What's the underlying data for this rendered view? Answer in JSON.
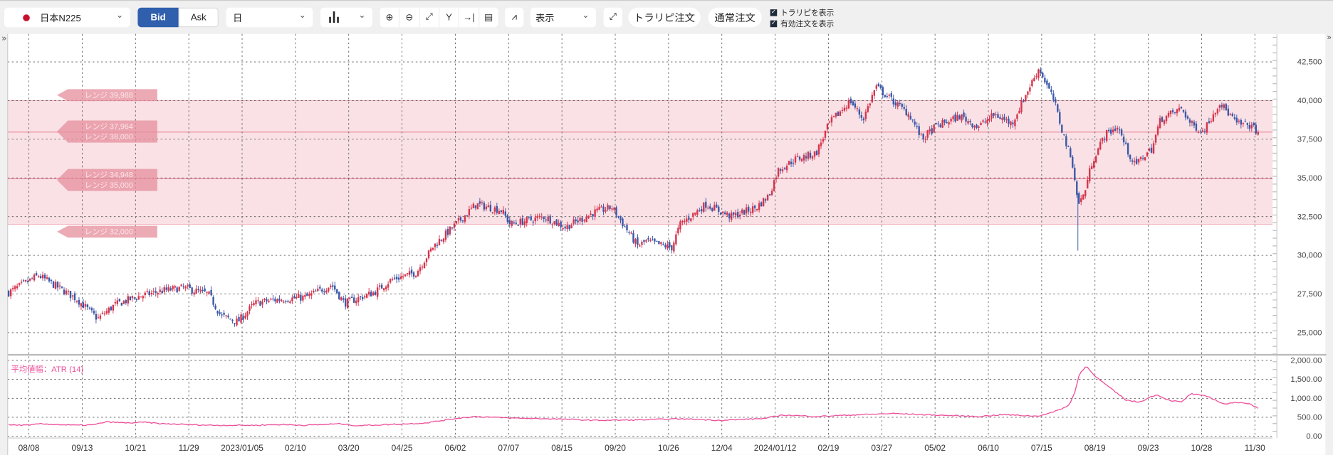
{
  "toolbar": {
    "symbol": "日本N225",
    "bid": "Bid",
    "ask": "Ask",
    "period": "日",
    "display": "表示",
    "trarepi_order": "トラリピ注文",
    "normal_order": "通常注文",
    "show_trarepi": "トラリピを表示",
    "show_active_orders": "有効注文を表示",
    "icons": [
      "zoom-in-icon",
      "zoom-out-icon",
      "fit-icon",
      "y-lock-icon",
      "scroll-end-icon",
      "document-icon"
    ]
  },
  "colors": {
    "up": "#d6344c",
    "down": "#3a58a8",
    "band": "#f9e1e5",
    "range_label": "#e58e9c",
    "atr": "#ee4f9a",
    "accent": "#2f5fad"
  },
  "ranges": [
    {
      "label": "レンジ 39,988",
      "value": 39988
    },
    {
      "label": "レンジ 37,964",
      "value": 37964
    },
    {
      "label": "レンジ 38,000",
      "value": 38000
    },
    {
      "label": "レンジ 34,948",
      "value": 34948
    },
    {
      "label": "レンジ 35,000",
      "value": 35000
    },
    {
      "label": "レンジ 32,000",
      "value": 32000
    }
  ],
  "atr_label": "平均値幅：ATR (14)",
  "chart_data": [
    {
      "type": "candlestick",
      "title": "日本N225",
      "ylim": [
        24000,
        43500
      ],
      "yticks": [
        "42,500",
        "40,000",
        "37,500",
        "35,000",
        "32,500",
        "30,000",
        "27,500",
        "25,000"
      ],
      "ytick_values": [
        42500,
        40000,
        37500,
        35000,
        32500,
        30000,
        27500,
        25000
      ],
      "xlabels": [
        "08/08",
        "09/13",
        "10/21",
        "11/29",
        "2023/01/05",
        "02/10",
        "03/20",
        "04/25",
        "06/02",
        "07/07",
        "08/15",
        "09/20",
        "10/26",
        "12/04",
        "2024/01/12",
        "02/19",
        "03/27",
        "05/02",
        "06/10",
        "07/15",
        "08/19",
        "09/23",
        "10/28",
        "11/30"
      ],
      "close_keypoints": [
        [
          -0.38,
          27600
        ],
        [
          0.18,
          28700
        ],
        [
          0.89,
          27200
        ],
        [
          1.29,
          25900
        ],
        [
          1.61,
          26800
        ],
        [
          2.01,
          27300
        ],
        [
          2.49,
          27700
        ],
        [
          2.89,
          27900
        ],
        [
          3.37,
          27500
        ],
        [
          3.6,
          26100
        ],
        [
          3.92,
          25700
        ],
        [
          4.24,
          26900
        ],
        [
          4.56,
          27100
        ],
        [
          5.2,
          27300
        ],
        [
          5.68,
          28100
        ],
        [
          5.92,
          26900
        ],
        [
          6.48,
          27600
        ],
        [
          6.79,
          28400
        ],
        [
          7.27,
          28900
        ],
        [
          7.59,
          30600
        ],
        [
          8.07,
          32200
        ],
        [
          8.39,
          33300
        ],
        [
          8.87,
          32900
        ],
        [
          9.03,
          32000
        ],
        [
          9.67,
          32500
        ],
        [
          10.06,
          31800
        ],
        [
          10.62,
          32800
        ],
        [
          10.94,
          33100
        ],
        [
          11.42,
          30600
        ],
        [
          11.58,
          30900
        ],
        [
          12.06,
          30500
        ],
        [
          12.22,
          32000
        ],
        [
          12.7,
          33300
        ],
        [
          13.17,
          32500
        ],
        [
          13.65,
          33100
        ],
        [
          13.89,
          33900
        ],
        [
          14.05,
          35500
        ],
        [
          14.37,
          36200
        ],
        [
          14.77,
          36600
        ],
        [
          15.01,
          38500
        ],
        [
          15.41,
          40000
        ],
        [
          15.65,
          38800
        ],
        [
          15.89,
          40900
        ],
        [
          16.2,
          40000
        ],
        [
          16.52,
          39100
        ],
        [
          16.76,
          37500
        ],
        [
          17.0,
          38300
        ],
        [
          17.48,
          39000
        ],
        [
          17.8,
          38300
        ],
        [
          18.12,
          39100
        ],
        [
          18.44,
          38500
        ],
        [
          18.76,
          40800
        ],
        [
          18.95,
          42100
        ],
        [
          19.23,
          40000
        ],
        [
          19.39,
          38000
        ],
        [
          19.59,
          35800
        ],
        [
          19.68,
          33300
        ],
        [
          19.79,
          33900
        ],
        [
          19.95,
          36100
        ],
        [
          20.19,
          37800
        ],
        [
          20.43,
          38300
        ],
        [
          20.59,
          36900
        ],
        [
          20.75,
          35800
        ],
        [
          20.91,
          36400
        ],
        [
          21.07,
          36900
        ],
        [
          21.23,
          38800
        ],
        [
          21.63,
          39500
        ],
        [
          21.79,
          38500
        ],
        [
          22.03,
          38000
        ],
        [
          22.34,
          39900
        ],
        [
          22.66,
          38500
        ],
        [
          22.9,
          38400
        ],
        [
          23.06,
          38000
        ]
      ]
    },
    {
      "type": "line",
      "title": "平均値幅：ATR (14)",
      "ylim": [
        0,
        2000
      ],
      "yticks": [
        "2,000.00",
        "1,500.00",
        "1,000.00",
        "500.00",
        "0.00"
      ],
      "ytick_values": [
        2000,
        1500,
        1000,
        500,
        0
      ],
      "keypoints": [
        [
          -0.38,
          300
        ],
        [
          0.02,
          290
        ],
        [
          0.18,
          330
        ],
        [
          0.89,
          290
        ],
        [
          1.21,
          300
        ],
        [
          1.45,
          380
        ],
        [
          1.85,
          350
        ],
        [
          2.17,
          370
        ],
        [
          2.49,
          330
        ],
        [
          3.44,
          290
        ],
        [
          4.24,
          290
        ],
        [
          4.72,
          310
        ],
        [
          5.2,
          290
        ],
        [
          5.84,
          330
        ],
        [
          6.16,
          280
        ],
        [
          6.95,
          320
        ],
        [
          7.43,
          350
        ],
        [
          8.07,
          480
        ],
        [
          8.39,
          520
        ],
        [
          9.03,
          480
        ],
        [
          9.82,
          460
        ],
        [
          10.62,
          420
        ],
        [
          11.42,
          430
        ],
        [
          12.22,
          460
        ],
        [
          13.01,
          420
        ],
        [
          13.81,
          470
        ],
        [
          14.13,
          560
        ],
        [
          14.77,
          520
        ],
        [
          15.41,
          560
        ],
        [
          16.2,
          600
        ],
        [
          17.0,
          560
        ],
        [
          17.8,
          520
        ],
        [
          18.28,
          570
        ],
        [
          18.92,
          530
        ],
        [
          19.23,
          640
        ],
        [
          19.52,
          820
        ],
        [
          19.63,
          1200
        ],
        [
          19.71,
          1650
        ],
        [
          19.84,
          1850
        ],
        [
          20.03,
          1550
        ],
        [
          20.35,
          1200
        ],
        [
          20.59,
          950
        ],
        [
          20.83,
          900
        ],
        [
          20.99,
          1000
        ],
        [
          21.15,
          1100
        ],
        [
          21.39,
          950
        ],
        [
          21.63,
          900
        ],
        [
          21.79,
          1120
        ],
        [
          22.11,
          1050
        ],
        [
          22.42,
          850
        ],
        [
          22.74,
          900
        ],
        [
          22.9,
          850
        ],
        [
          23.06,
          750
        ]
      ]
    }
  ]
}
